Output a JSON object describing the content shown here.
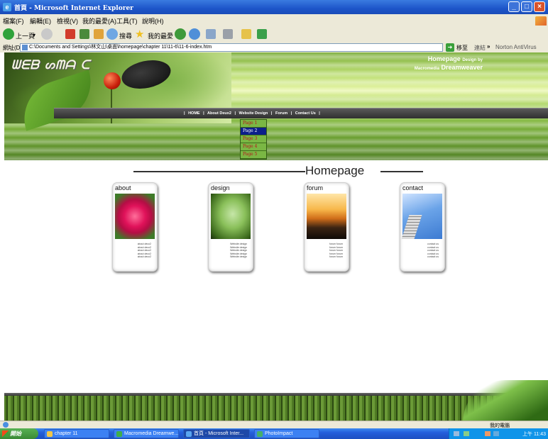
{
  "window": {
    "title": "首頁 - Microsoft Internet Explorer"
  },
  "menu": [
    "檔案(F)",
    "編輯(E)",
    "檢視(V)",
    "我的最愛(A)",
    "工具(T)",
    "說明(H)"
  ],
  "toolbar": {
    "back": "上一頁",
    "search": "搜尋",
    "favorites": "我的最愛"
  },
  "address": {
    "label": "網址(D)",
    "url": "C:\\Documents and Settings\\林文山\\桌面\\homepage\\chapter 11\\11-6\\11-6-index.htm",
    "go": "移至",
    "links": "連結",
    "more": "»",
    "norton": "Norton AntiVirus"
  },
  "banner": {
    "logo": "ᗯᗴᗷ ᔕᗰᗩ ᑕ",
    "credit_line1": "Homepage",
    "credit_line1_small": "Design by",
    "credit_line2_small": "Macromedia",
    "credit_line2": "Dreamweaver"
  },
  "nav": {
    "items": [
      "HOME",
      "About Deux2",
      "Website Design",
      "Forum",
      "Contact Us"
    ],
    "separator": "|"
  },
  "dropdown": {
    "items": [
      "Page 1",
      "Page 2",
      "Page 3",
      "Page 4",
      "Page 5"
    ],
    "selected_index": 1
  },
  "page": {
    "headline": "Homepage"
  },
  "cards": [
    {
      "title": "about",
      "lines": [
        "about deux2",
        "about deux2",
        "about deux2",
        "about deux2",
        "about deux2"
      ]
    },
    {
      "title": "design",
      "lines": [
        "Website design",
        "Website design",
        "Website design",
        "Website design",
        "Website design"
      ]
    },
    {
      "title": "forum",
      "lines": [
        "forum forum",
        "forum forum",
        "forum forum",
        "forum forum",
        "forum forum"
      ]
    },
    {
      "title": "contact",
      "lines": [
        "contact us",
        "contact us",
        "contact us",
        "contact us",
        "contact us"
      ]
    }
  ],
  "statusbar": {
    "zone": "我的電腦"
  },
  "taskbar": {
    "start": "開始",
    "tasks": [
      "chapter 11",
      "Macromedia Dreamwe...",
      "首頁 - Microsoft Inter...",
      "PhotoImpact"
    ],
    "active_index": 2,
    "clock": "上午 11:43"
  },
  "colors": {
    "nav_bg": "#3f3f3f",
    "dropdown_sel": "#0c1f8a",
    "dropdown_text": "#b8111b",
    "banner_green": "#8cc34a"
  }
}
